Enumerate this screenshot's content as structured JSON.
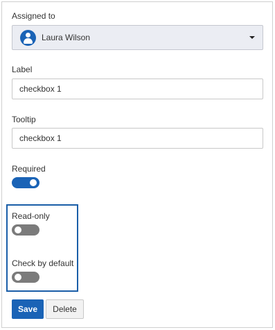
{
  "assigned_to": {
    "label": "Assigned to",
    "value": "Laura Wilson"
  },
  "label_field": {
    "label": "Label",
    "value": "checkbox 1"
  },
  "tooltip_field": {
    "label": "Tooltip",
    "value": "checkbox 1"
  },
  "toggles": {
    "required": {
      "label": "Required",
      "on": true
    },
    "read_only": {
      "label": "Read-only",
      "on": false
    },
    "check_by_default": {
      "label": "Check by default",
      "on": false
    }
  },
  "actions": {
    "save_label": "Save",
    "delete_label": "Delete"
  },
  "colors": {
    "accent": "#1a63b6",
    "toggle_off": "#7b7b7b",
    "highlight": "#1a5ea8"
  }
}
